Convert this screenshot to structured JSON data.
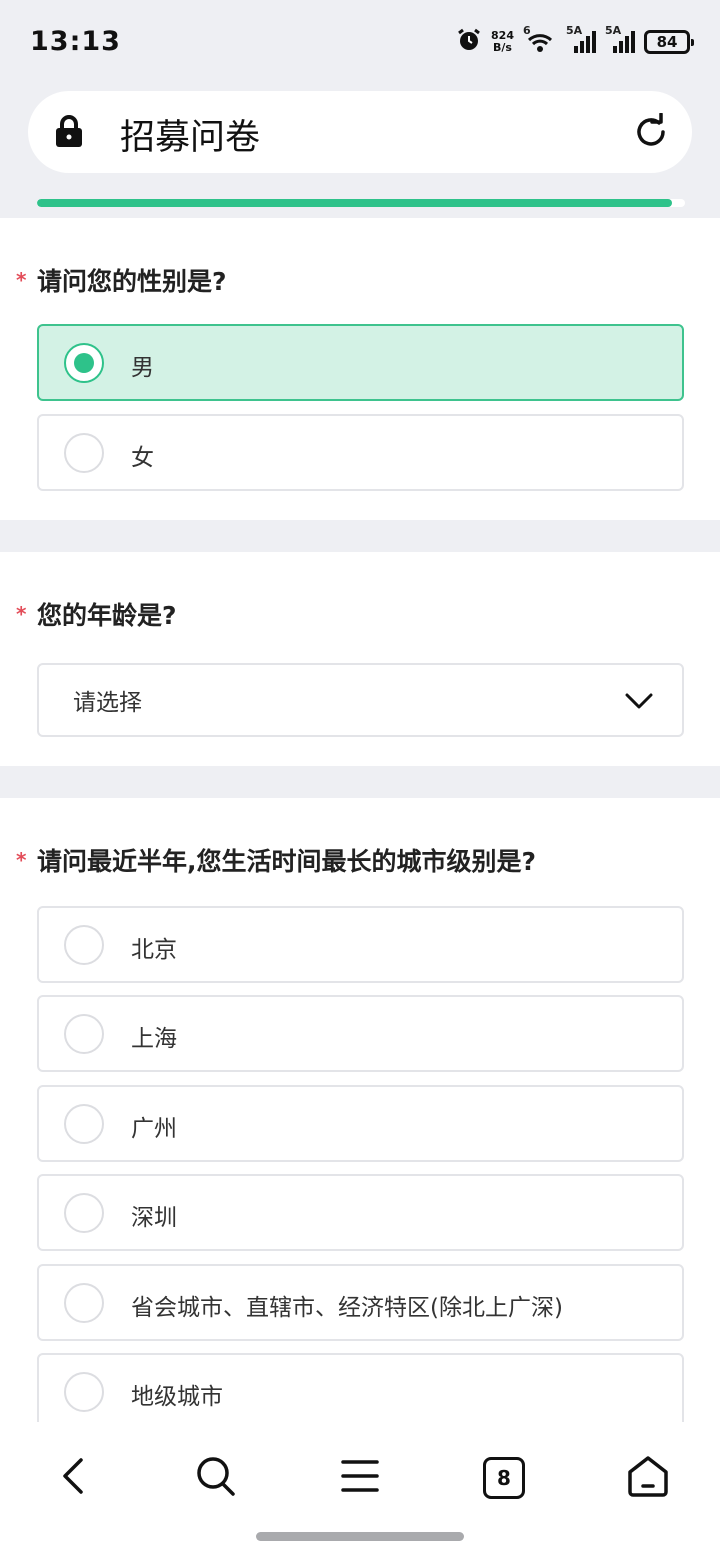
{
  "status_bar": {
    "time": "13:13",
    "net_speed_value": "824",
    "net_speed_unit": "B/s",
    "wifi_badge": "6",
    "sim1_badge": "5A",
    "sim2_badge": "5A",
    "battery": "84"
  },
  "url_bar": {
    "title": "招募问卷"
  },
  "progress": {
    "fraction": 0.98
  },
  "questions": [
    {
      "required_mark": "*",
      "title": "请问您的性别是?",
      "options": [
        {
          "label": "男",
          "selected": true
        },
        {
          "label": "女",
          "selected": false
        }
      ]
    },
    {
      "required_mark": "*",
      "title": "您的年龄是?",
      "select_value": "请选择"
    },
    {
      "required_mark": "*",
      "title": "请问最近半年,您生活时间最长的城市级别是?",
      "options": [
        {
          "label": "北京",
          "selected": false
        },
        {
          "label": "上海",
          "selected": false
        },
        {
          "label": "广州",
          "selected": false
        },
        {
          "label": "深圳",
          "selected": false
        },
        {
          "label": "省会城市、直辖市、经济特区(除北上广深)",
          "selected": false
        },
        {
          "label": "地级城市",
          "selected": false
        }
      ]
    }
  ],
  "bottom_nav": {
    "tab_count": "8"
  },
  "colors": {
    "accent": "#2ec28a",
    "selected_bg": "#d3f2e5",
    "required": "#e34d59",
    "page_bg": "#eeeff3"
  }
}
